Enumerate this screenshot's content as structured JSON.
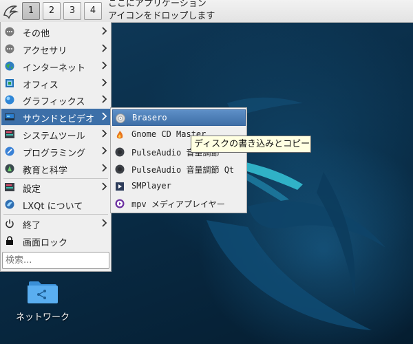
{
  "panel": {
    "workspaces": [
      "1",
      "2",
      "3",
      "4"
    ],
    "active_workspace": "1",
    "quicklaunch_hint": "ここにアプリケーション\nアイコンをドロップします"
  },
  "menu": {
    "items": [
      {
        "label": "その他",
        "icon": "more-icon"
      },
      {
        "label": "アクセサリ",
        "icon": "accessories-icon"
      },
      {
        "label": "インターネット",
        "icon": "globe-icon"
      },
      {
        "label": "オフィス",
        "icon": "office-icon"
      },
      {
        "label": "グラフィックス",
        "icon": "graphics-icon"
      },
      {
        "label": "サウンドとビデオ",
        "icon": "multimedia-icon"
      },
      {
        "label": "システムツール",
        "icon": "system-tools-icon"
      },
      {
        "label": "プログラミング",
        "icon": "programming-icon"
      },
      {
        "label": "教育と科学",
        "icon": "education-icon"
      },
      {
        "label": "設定",
        "icon": "settings-icon"
      },
      {
        "label": "LXQt について",
        "icon": "lxqt-icon"
      },
      {
        "label": "終了",
        "icon": "power-icon"
      },
      {
        "label": "画面ロック",
        "icon": "lock-icon"
      }
    ],
    "search_placeholder": "検索..."
  },
  "submenu": {
    "items": [
      {
        "label": "Brasero",
        "icon": "brasero-icon"
      },
      {
        "label": "Gnome CD Master",
        "icon": "gnome-cd-master-icon"
      },
      {
        "label": "PulseAudio 音量調節",
        "icon": "pulseaudio-icon"
      },
      {
        "label": "PulseAudio 音量調節 Qt",
        "icon": "pulseaudio-qt-icon"
      },
      {
        "label": "SMPlayer",
        "icon": "smplayer-icon"
      },
      {
        "label": "mpv メディアプレイヤー",
        "icon": "mpv-icon"
      }
    ]
  },
  "tooltip": "ディスクの書き込みとコピー",
  "desktop": {
    "network_icon_label": "ネットワーク"
  },
  "colors": {
    "menu_highlight": "#3c6fa8",
    "submenu_highlight": "#4f80b9",
    "desktop_bg": "#0b2f4a"
  }
}
